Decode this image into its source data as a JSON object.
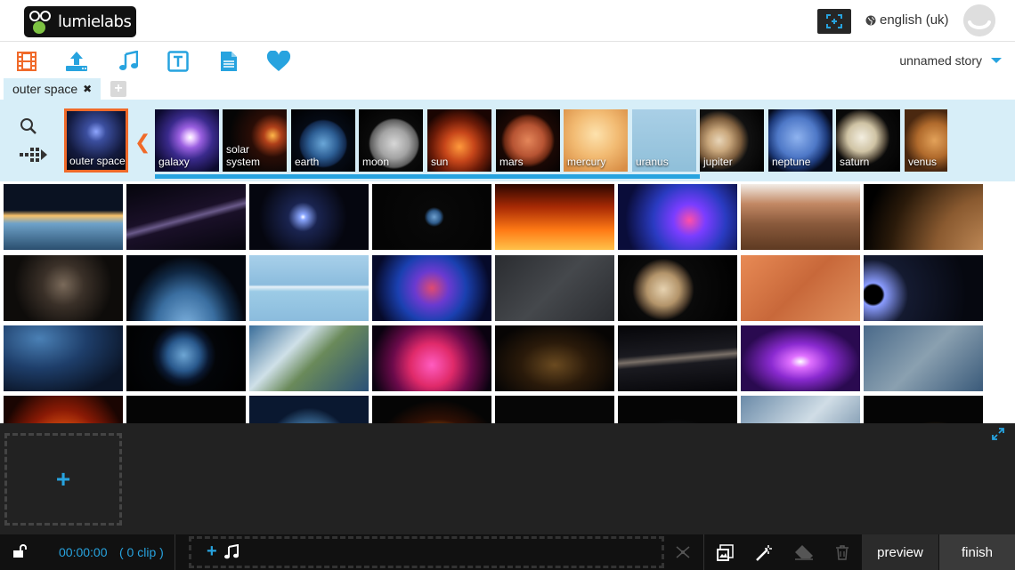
{
  "header": {
    "logo_text": "lumielabs",
    "language": "english (uk)"
  },
  "toolbar": {
    "story_title": "unnamed story",
    "tools": [
      "video-icon",
      "upload-icon",
      "music-icon",
      "text-icon",
      "document-icon",
      "heart-icon"
    ]
  },
  "tabs": {
    "active_tab": "outer space",
    "close_glyph": "✖",
    "add_glyph": "+"
  },
  "categories": {
    "active": "outer space",
    "items": [
      {
        "label": "galaxy"
      },
      {
        "label": "solar system"
      },
      {
        "label": "earth"
      },
      {
        "label": "moon"
      },
      {
        "label": "sun"
      },
      {
        "label": "mars"
      },
      {
        "label": "mercury"
      },
      {
        "label": "uranus"
      },
      {
        "label": "jupiter"
      },
      {
        "label": "neptune"
      },
      {
        "label": "saturn"
      },
      {
        "label": "venus"
      }
    ]
  },
  "timeline": {
    "add_glyph": "+"
  },
  "bottom": {
    "time": "00:00:00",
    "clip_count": "( 0 clip )",
    "audio_add_glyph": "+",
    "preview_label": "preview",
    "finish_label": "finish"
  },
  "colors": {
    "accent_blue": "#27a3df",
    "accent_orange": "#f06a2a",
    "band_bg": "#d7eef8",
    "timeline_bg": "#222222"
  }
}
